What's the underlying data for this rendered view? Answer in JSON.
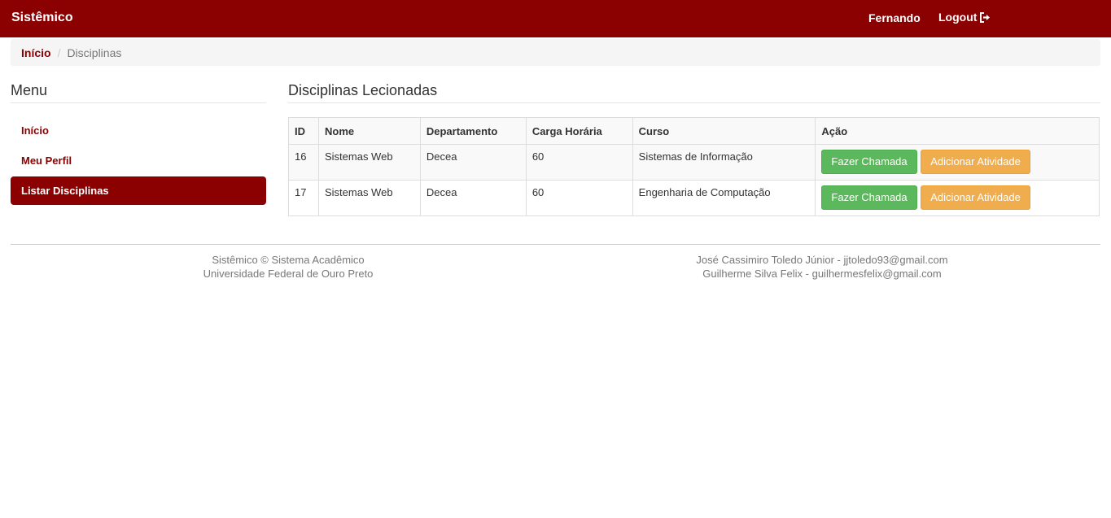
{
  "navbar": {
    "brand": "Sistêmico",
    "user": "Fernando",
    "logout": "Logout",
    "logout_icon": "logout-icon",
    "color": "#8b0000"
  },
  "breadcrumb": {
    "home": "Início",
    "separator": "/",
    "current": "Disciplinas"
  },
  "sidebar": {
    "title": "Menu",
    "items": [
      {
        "label": "Início",
        "active": false
      },
      {
        "label": "Meu Perfil",
        "active": false
      },
      {
        "label": "Listar Disciplinas",
        "active": true
      }
    ]
  },
  "main": {
    "title": "Disciplinas Lecionadas",
    "table": {
      "headers": [
        "ID",
        "Nome",
        "Departamento",
        "Carga Horária",
        "Curso",
        "Ação"
      ],
      "rows": [
        {
          "id": "16",
          "nome": "Sistemas Web",
          "departamento": "Decea",
          "carga": "60",
          "curso": "Sistemas de Informação"
        },
        {
          "id": "17",
          "nome": "Sistemas Web",
          "departamento": "Decea",
          "carga": "60",
          "curso": "Engenharia de Computação"
        }
      ],
      "action_primary": "Fazer Chamada",
      "action_secondary": "Adicionar Atividade"
    }
  },
  "footer": {
    "left_line1": "Sistêmico © Sistema Acadêmico",
    "left_line2": "Universidade Federal de Ouro Preto",
    "right_line1": "José Cassimiro Toledo Júnior - jjtoledo93@gmail.com",
    "right_line2": "Guilherme Silva Felix - guilhermesfelix@gmail.com"
  },
  "colors": {
    "brand": "#8b0000",
    "success": "#5cb85c",
    "warning": "#f0ad4e"
  }
}
